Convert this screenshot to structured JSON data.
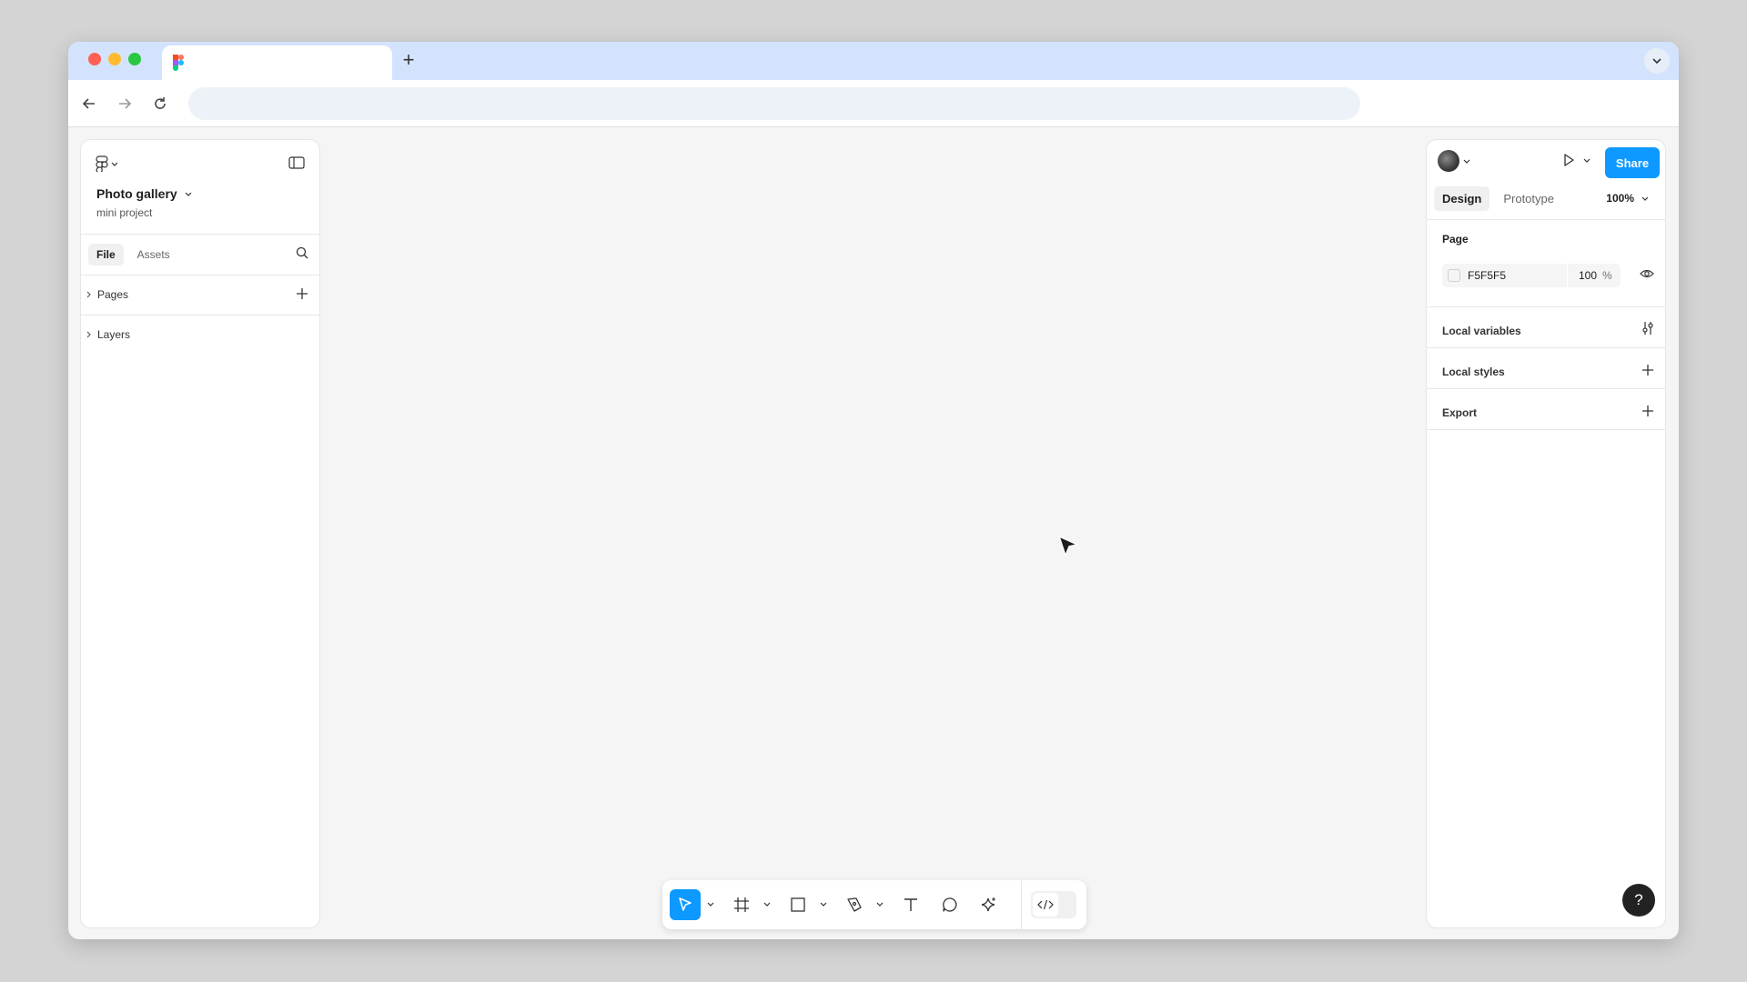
{
  "left_panel": {
    "file_title": "Photo gallery",
    "file_subtitle": "mini project",
    "tabs": [
      {
        "label": "File",
        "active": true
      },
      {
        "label": "Assets",
        "active": false
      }
    ],
    "sections": [
      {
        "label": "Pages"
      },
      {
        "label": "Layers"
      }
    ]
  },
  "right_panel": {
    "share_label": "Share",
    "tabs": [
      {
        "label": "Design",
        "active": true
      },
      {
        "label": "Prototype",
        "active": false
      }
    ],
    "zoom": "100%",
    "page_section": {
      "label": "Page",
      "background_hex": "F5F5F5",
      "opacity": "100",
      "opacity_unit": "%"
    },
    "rows": [
      {
        "label": "Local variables",
        "icon": "sliders-icon"
      },
      {
        "label": "Local styles",
        "icon": "plus-icon"
      },
      {
        "label": "Export",
        "icon": "plus-icon"
      }
    ],
    "help_label": "?"
  },
  "toolbar": {
    "tools": [
      {
        "name": "move",
        "icon": "cursor-icon",
        "active": true
      },
      {
        "name": "frame",
        "icon": "frame-icon",
        "active": false
      },
      {
        "name": "rectangle",
        "icon": "rectangle-icon",
        "active": false
      },
      {
        "name": "pen",
        "icon": "pen-icon",
        "active": false
      },
      {
        "name": "text",
        "icon": "text-icon",
        "active": false
      },
      {
        "name": "comment",
        "icon": "comment-icon",
        "active": false
      },
      {
        "name": "actions",
        "icon": "sparkle-icon",
        "active": false
      },
      {
        "name": "dev-mode",
        "icon": "code-icon",
        "active": false
      }
    ]
  },
  "colors": {
    "accent": "#0d99ff",
    "canvas": "#f5f5f5",
    "browser_tabbar": "#d3e3fd"
  }
}
